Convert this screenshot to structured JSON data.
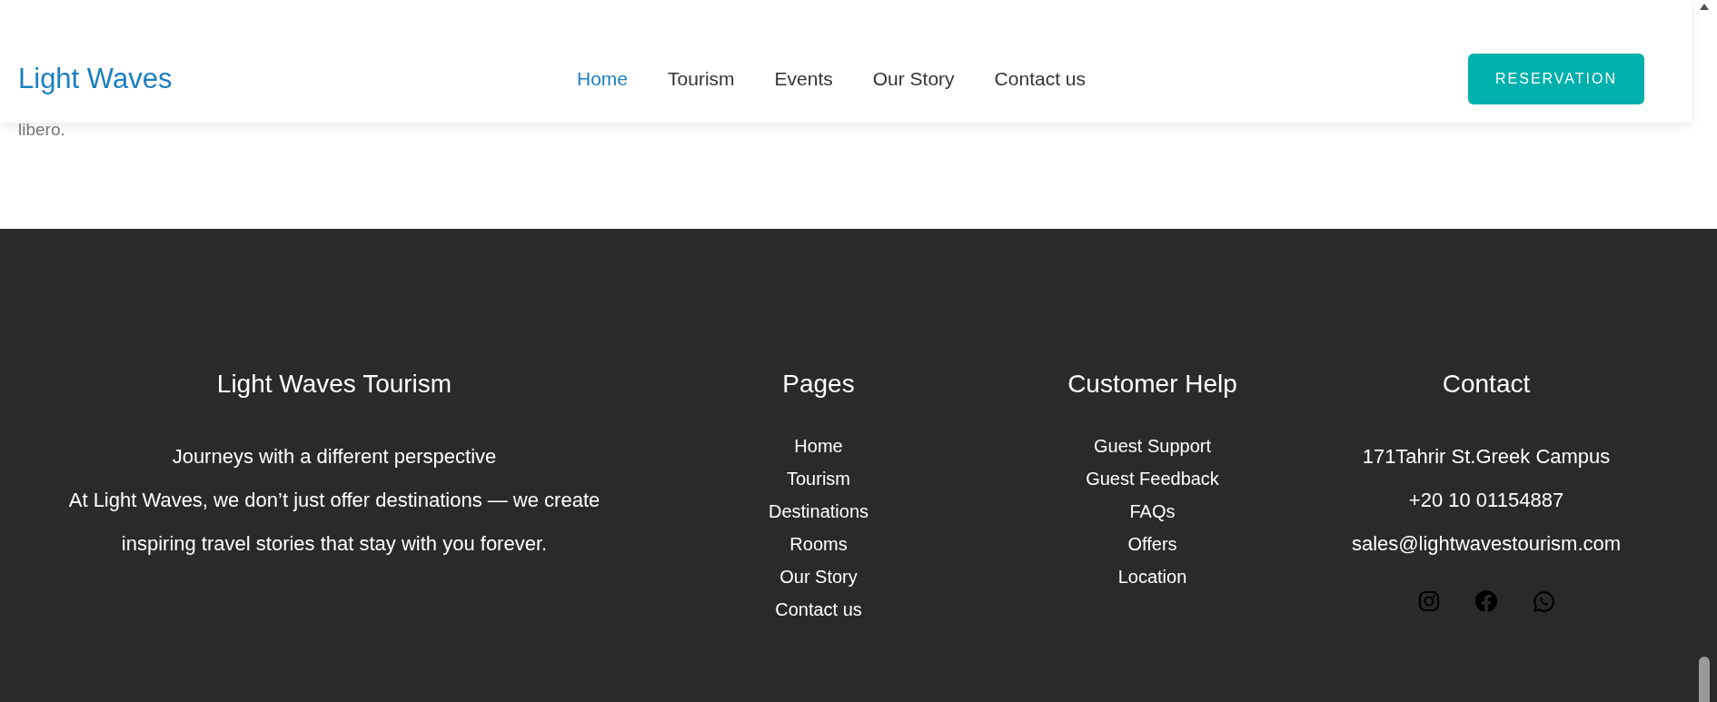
{
  "header": {
    "logo": "Light Waves",
    "nav": [
      {
        "label": "Home",
        "selected": true
      },
      {
        "label": "Tourism",
        "selected": false
      },
      {
        "label": "Events",
        "selected": false
      },
      {
        "label": "Our Story",
        "selected": false
      },
      {
        "label": "Contact us",
        "selected": false
      }
    ],
    "button": "RESERVATION"
  },
  "body_text": "libero.",
  "footer": {
    "about": {
      "title": "Light Waves Tourism",
      "lines": [
        "Journeys with a different perspective",
        "At Light Waves, we don’t just offer destinations — we create",
        "inspiring travel stories that stay with you forever."
      ]
    },
    "pages": {
      "title": "Pages",
      "links": [
        "Home",
        "Tourism",
        "Destinations",
        "Rooms",
        "Our Story",
        "Contact us"
      ]
    },
    "help": {
      "title": "Customer Help",
      "links": [
        "Guest Support",
        "Guest Feedback",
        "FAQs",
        "Offers",
        "Location"
      ]
    },
    "contact": {
      "title": "Contact",
      "lines": [
        "171Tahrir St.Greek Campus",
        "+20 10 01154887",
        "sales@lightwavestourism.com"
      ],
      "social": [
        {
          "kind": "instagram"
        },
        {
          "kind": "facebook"
        },
        {
          "kind": "whatsapp"
        }
      ]
    }
  }
}
